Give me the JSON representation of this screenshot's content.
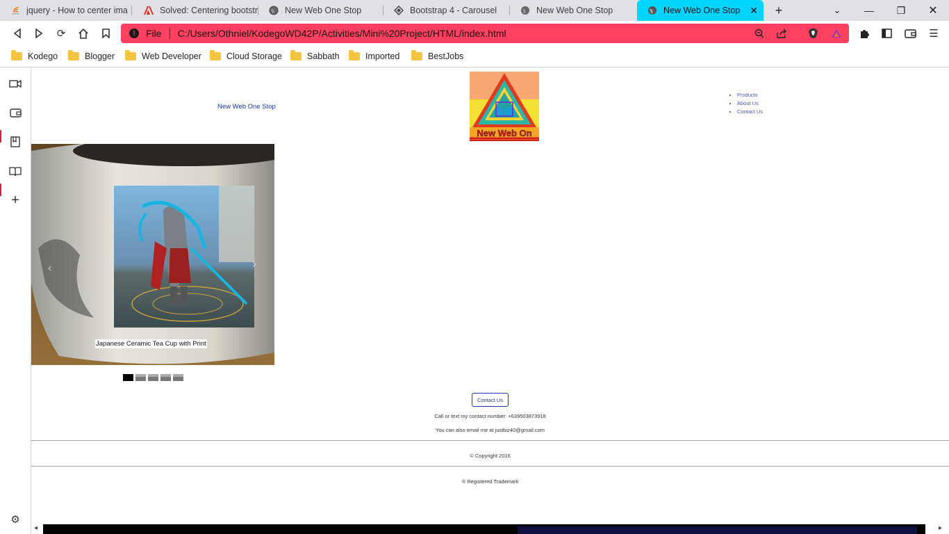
{
  "tabs": [
    {
      "title": "jquery - How to center ima",
      "icon": "stackoverflow-icon",
      "icon_color": "#f48024"
    },
    {
      "title": "Solved: Centering bootstrap",
      "icon": "adobe-icon",
      "icon_color": "#e1251b"
    },
    {
      "title": "New Web One Stop",
      "icon": "globe-icon",
      "icon_color": "#555555"
    },
    {
      "title": "Bootstrap 4 - Carousel",
      "icon": "diamond-icon",
      "icon_color": "#555555"
    },
    {
      "title": "New Web One Stop",
      "icon": "globe-icon",
      "icon_color": "#555555"
    },
    {
      "title": "New Web One Stop",
      "icon": "globe-icon",
      "icon_color": "#555555",
      "active": true
    }
  ],
  "address_bar": {
    "scheme": "File",
    "url": "C:/Users/Othniel/KodegoWD42P/Activities/Mini%20Project/HTML/index.html",
    "color": "#ff4060"
  },
  "bookmarks": [
    "Kodego",
    "Blogger",
    "Web Developer",
    "Cloud Storage",
    "Sabbath",
    "Imported",
    "BestJobs"
  ],
  "page": {
    "brand": "New Web One Stop",
    "logo_text": "New Web On",
    "nav": [
      "Products",
      "About Us",
      "Contact Us"
    ],
    "carousel": {
      "caption": "Japanese Ceramic Tea Cup with Print",
      "slide_count": 5,
      "active_index": 0
    },
    "contact_button": "Contact Us",
    "phone_line": "Call or text my contact number: +639503873918",
    "email_line": "You can also email me at justbiz40@gmail.com",
    "copyright": "© Copyright 2016",
    "trademark": "® Registered Trademark"
  }
}
